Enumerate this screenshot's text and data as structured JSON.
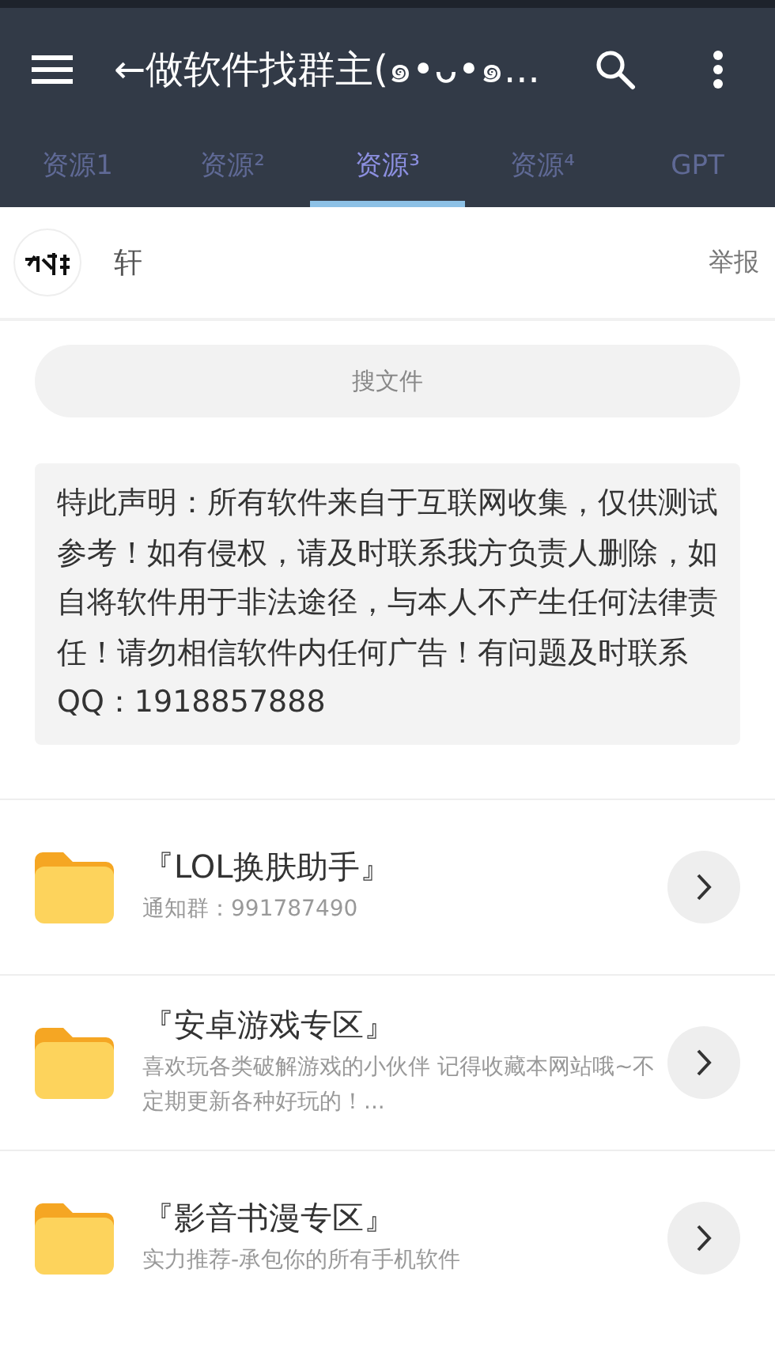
{
  "app_bar": {
    "title": "←做软件找群主(๑•ᴗ•๑..."
  },
  "tabs": [
    {
      "label": "资源1",
      "selected": false
    },
    {
      "label": "资源²",
      "selected": false
    },
    {
      "label": "资源³",
      "selected": true
    },
    {
      "label": "资源⁴",
      "selected": false
    },
    {
      "label": "GPT",
      "selected": false
    }
  ],
  "user": {
    "name": "轩",
    "report": "举报"
  },
  "search": {
    "placeholder": "搜文件"
  },
  "notice": "特此声明：所有软件来自于互联网收集，仅供测试参考！如有侵权，请及时联系我方负责人删除，如自将软件用于非法途径，与本人不产生任何法律责任！请勿相信软件内任何广告！有问题及时联系QQ：1918857888",
  "folders": [
    {
      "title": "『LOL换肤助手』",
      "subtitle": "通知群：991787490"
    },
    {
      "title": "『安卓游戏专区』",
      "subtitle": "喜欢玩各类破解游戏的小伙伴 记得收藏本网站哦~不定期更新各种好玩的！..."
    },
    {
      "title": "『影音书漫专区』",
      "subtitle": "实力推荐-承包你的所有手机软件"
    }
  ]
}
